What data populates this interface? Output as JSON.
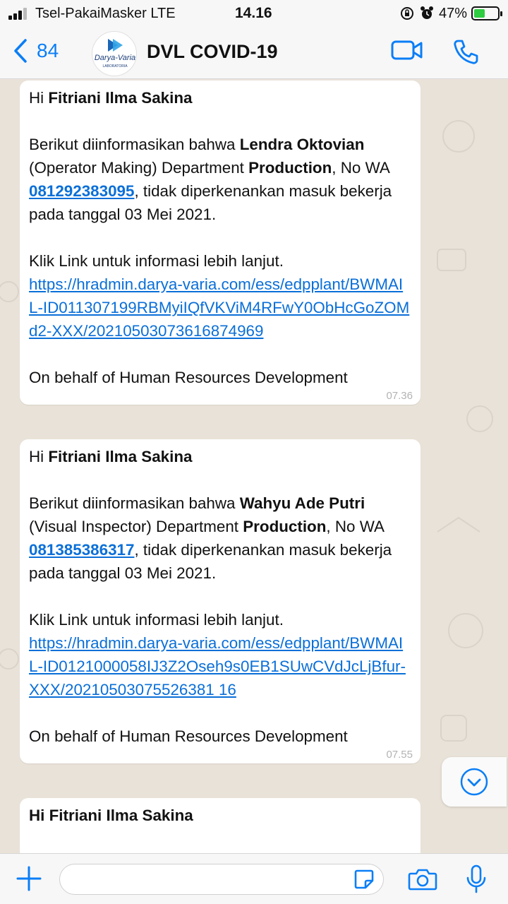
{
  "status_bar": {
    "carrier": "Tsel-PakaiMasker  LTE",
    "time": "14.16",
    "battery_percent": "47%",
    "battery_level": 0.47
  },
  "header": {
    "back_count": "84",
    "avatar_logo_text": "Darya-Varia",
    "avatar_logo_subtext": "LABORATORIA",
    "title": "DVL COVID-19",
    "accent_color": "#0a7ef7"
  },
  "messages": [
    {
      "greeting_prefix": "Hi ",
      "greeting_name": "Fitriani Ilma Sakina",
      "intro": "Berikut diinformasikan bahwa ",
      "employee_name": "Lendra Oktovian",
      "role": "(Operator Making) Department ",
      "department": "Production",
      "no_wa_label": ", No WA ",
      "phone": "081292383095",
      "after_phone": ", tidak diperkenankan masuk bekerja pada tanggal 03 Mei 2021.",
      "link_intro": "Klik Link untuk informasi lebih lanjut.",
      "link": "https://hradmin.darya-varia.com/ess/edpplant/BWMAIL-ID011307199RBMyiIQfVKViM4RFwY0ObHcGoZOMd2-XXX/20210503073616874969",
      "footer": "On behalf of Human Resources Development",
      "time": "07.36"
    },
    {
      "greeting_prefix": "Hi ",
      "greeting_name": "Fitriani Ilma Sakina",
      "intro": "Berikut diinformasikan bahwa ",
      "employee_name": "Wahyu Ade Putri",
      "role": "(Visual Inspector) Department ",
      "department": "Production",
      "no_wa_label": ", No WA ",
      "phone": "081385386317",
      "after_phone": ", tidak diperkenankan masuk bekerja pada tanggal 03 Mei 2021.",
      "link_intro": "Klik Link untuk informasi lebih lanjut.",
      "link": "https://hradmin.darya-varia.com/ess/edpplant/BWMAIL-ID0121000058IJ3Z2Oseh9s0EB1SUwCVdJcLjBfur-XXX/20210503075526381 16",
      "footer": "On behalf of Human Resources Development",
      "time": "07.55"
    },
    {
      "greeting_prefix": "Hi ",
      "greeting_name": "Fitriani Ilma Sakina"
    }
  ],
  "input_bar": {
    "placeholder": ""
  },
  "icons": {
    "back": "chevron-left-icon",
    "video": "video-camera-icon",
    "call": "phone-icon",
    "scroll": "chevron-down-circle-icon",
    "plus": "plus-icon",
    "sticker": "sticker-icon",
    "camera": "camera-icon",
    "mic": "microphone-icon"
  }
}
